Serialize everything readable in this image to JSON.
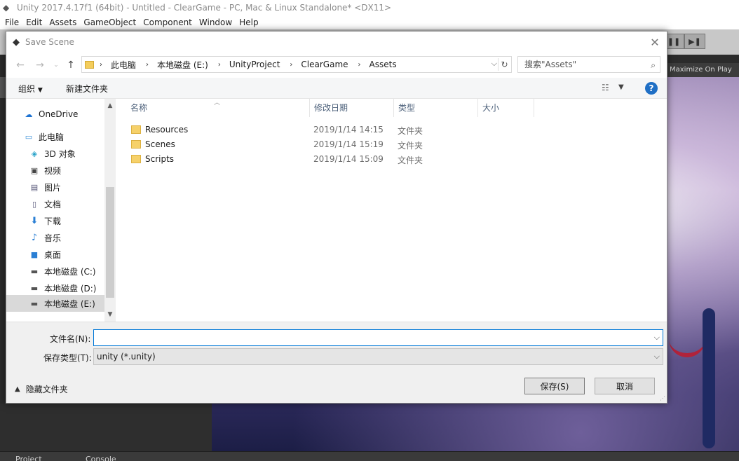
{
  "unity": {
    "window_title": "Unity 2017.4.17f1 (64bit) - Untitled - ClearGame - PC, Mac & Linux Standalone* <DX11>",
    "menu": [
      "File",
      "Edit",
      "Assets",
      "GameObject",
      "Component",
      "Window",
      "Help"
    ],
    "game_bar_label": "Maximize On Play",
    "bottom_tabs": [
      "Project",
      "Console"
    ]
  },
  "dialog": {
    "title": "Save Scene",
    "breadcrumb": [
      "此电脑",
      "本地磁盘 (E:)",
      "UnityProject",
      "ClearGame",
      "Assets"
    ],
    "search_placeholder": "搜索\"Assets\"",
    "organize_label": "组织",
    "new_folder_label": "新建文件夹",
    "nav_items": [
      {
        "label": "OneDrive",
        "icon": "cloud-icon"
      },
      {
        "label": "此电脑",
        "icon": "computer-icon"
      },
      {
        "label": "3D 对象",
        "icon": "cube-icon"
      },
      {
        "label": "视频",
        "icon": "video-icon"
      },
      {
        "label": "图片",
        "icon": "picture-icon"
      },
      {
        "label": "文档",
        "icon": "document-icon"
      },
      {
        "label": "下载",
        "icon": "download-icon"
      },
      {
        "label": "音乐",
        "icon": "music-icon"
      },
      {
        "label": "桌面",
        "icon": "desktop-icon"
      },
      {
        "label": "本地磁盘 (C:)",
        "icon": "drive-icon"
      },
      {
        "label": "本地磁盘 (D:)",
        "icon": "drive-icon"
      },
      {
        "label": "本地磁盘 (E:)",
        "icon": "drive-icon",
        "selected": true
      }
    ],
    "columns": [
      "名称",
      "修改日期",
      "类型",
      "大小"
    ],
    "files": [
      {
        "name": "Resources",
        "date": "2019/1/14 14:15",
        "type": "文件夹"
      },
      {
        "name": "Scenes",
        "date": "2019/1/14 15:19",
        "type": "文件夹"
      },
      {
        "name": "Scripts",
        "date": "2019/1/14 15:09",
        "type": "文件夹"
      }
    ],
    "filename_label": "文件名(N):",
    "filename_value": "",
    "filetype_label": "保存类型(T):",
    "filetype_value": "unity (*.unity)",
    "hide_folders_label": "隐藏文件夹",
    "save_label": "保存(S)",
    "cancel_label": "取消"
  }
}
